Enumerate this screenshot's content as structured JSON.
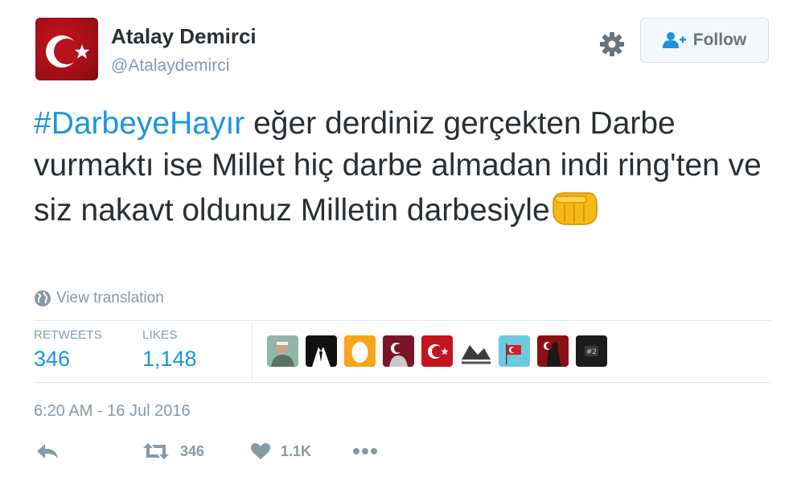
{
  "user": {
    "fullname": "Atalay Demirci",
    "screenname": "@Atalaydemirci",
    "avatar": "turkish-flag-avatar"
  },
  "header": {
    "follow_label": "Follow",
    "settings_icon": "gear-icon",
    "follow_icon": "add-user-icon"
  },
  "tweet": {
    "hashtag": "#DarbeyeHayır",
    "text": " eğer derdiniz gerçekten Darbe vurmaktı ise Millet hiç darbe almadan indi ring'ten ve siz nakavt oldunuz Milletin darbesiyle",
    "emoji": "oncoming-fist-emoji"
  },
  "translation": {
    "label": "View translation",
    "icon": "globe-icon"
  },
  "stats": {
    "retweets_label": "RETWEETS",
    "retweets_value": "346",
    "likes_label": "LIKES",
    "likes_value": "1,148"
  },
  "timestamp": "6:20 AM - 16 Jul 2016",
  "actions": {
    "retweet_count": "346",
    "like_count": "1.1K",
    "reply_icon": "reply-icon",
    "retweet_icon": "retweet-icon",
    "like_icon": "heart-icon",
    "more_icon": "more-icon"
  },
  "colors": {
    "link": "#1b95e0",
    "text": "#292f33",
    "muted": "#8899a6",
    "border": "#e1e8ed"
  }
}
